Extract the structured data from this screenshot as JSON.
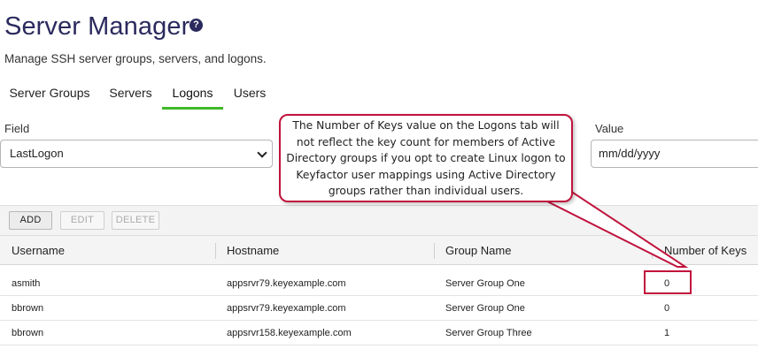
{
  "header": {
    "title": "Server Manager",
    "help_icon": "help-icon",
    "help_glyph": "?",
    "subtitle": "Manage SSH server groups, servers, and logons."
  },
  "tabs": [
    {
      "label": "Server Groups",
      "active": false
    },
    {
      "label": "Servers",
      "active": false
    },
    {
      "label": "Logons",
      "active": true
    },
    {
      "label": "Users",
      "active": false
    }
  ],
  "search": {
    "field_label": "Field",
    "field_value": "LastLogon",
    "value_label": "Value",
    "value_placeholder": "mm/dd/yyyy"
  },
  "toolbar": {
    "add_label": "ADD",
    "edit_label": "EDIT",
    "delete_label": "DELETE"
  },
  "table": {
    "columns": [
      "Username",
      "Hostname",
      "Group Name",
      "Number of Keys"
    ],
    "rows": [
      {
        "username": "asmith",
        "hostname": "appsrvr79.keyexample.com",
        "group": "Server Group One",
        "keys": "0"
      },
      {
        "username": "bbrown",
        "hostname": "appsrvr79.keyexample.com",
        "group": "Server Group One",
        "keys": "0"
      },
      {
        "username": "bbrown",
        "hostname": "appsrvr158.keyexample.com",
        "group": "Server Group Three",
        "keys": "1"
      }
    ]
  },
  "callout": {
    "text": "The Number of Keys value on the Logons tab will not reflect the key count for members of Active Directory groups if you opt to create Linux logon to Keyfactor user mappings using Active Directory groups rather than individual users."
  },
  "colors": {
    "title": "#2b2a5e",
    "active_tab": "#3fb82a",
    "annotation": "#c0143c"
  }
}
